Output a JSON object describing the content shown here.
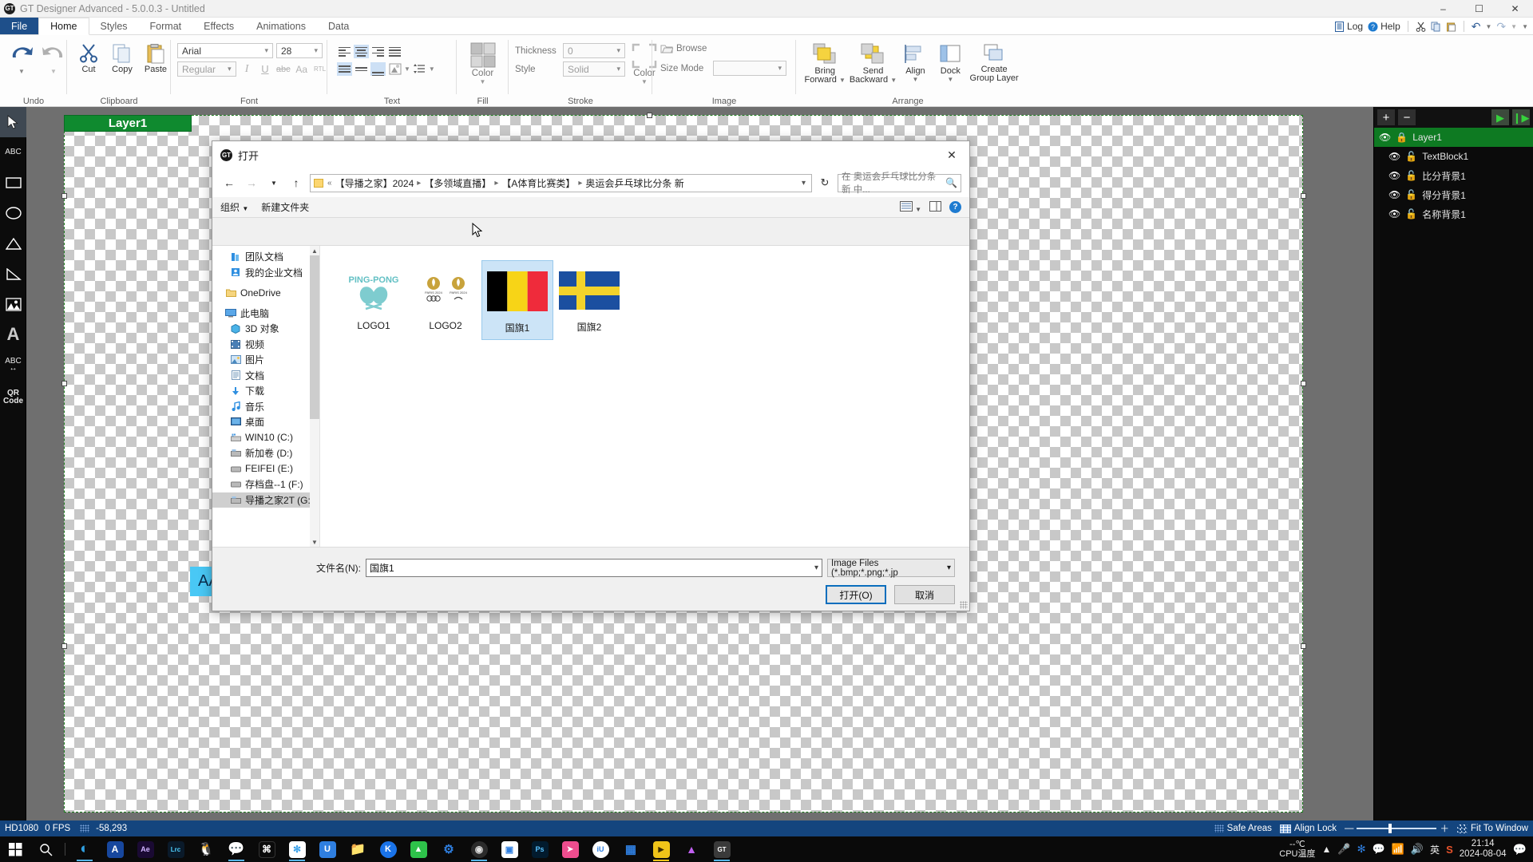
{
  "window": {
    "title": "GT Designer Advanced - 5.0.0.3 - Untitled",
    "app_icon": "gt-app-icon",
    "controls": {
      "minimize": "–",
      "maximize": "☐",
      "close": "✕"
    }
  },
  "ribbon": {
    "tabs": [
      {
        "label": "File",
        "kind": "file"
      },
      {
        "label": "Home",
        "kind": "active"
      },
      {
        "label": "Styles",
        "kind": "normal"
      },
      {
        "label": "Format",
        "kind": "normal"
      },
      {
        "label": "Effects",
        "kind": "normal"
      },
      {
        "label": "Animations",
        "kind": "normal"
      },
      {
        "label": "Data",
        "kind": "normal"
      }
    ],
    "quick_access": {
      "log_label": "Log",
      "help_label": "Help",
      "cut_icon": "cut-icon",
      "copy_icon": "copy-icon",
      "paste_icon": "paste-icon",
      "undo_icon": "undo-icon",
      "redo_icon": "redo-icon",
      "more_icon": "chevron-down-icon"
    },
    "groups": {
      "undo": {
        "label": "Undo",
        "undo_icon": "undo-arrow-icon",
        "redo_icon": "redo-arrow-icon"
      },
      "clipboard": {
        "label": "Clipboard",
        "cut": "Cut",
        "copy": "Copy",
        "paste": "Paste"
      },
      "font": {
        "label": "Font",
        "family_value": "Arial",
        "size_value": "28",
        "style_value": "Regular",
        "italic": "I",
        "underline": "U",
        "strike": "abc",
        "case": "Aa",
        "rtl": "RTL"
      },
      "text": {
        "label": "Text",
        "align_left": "align-left-icon",
        "align_center": "align-center-icon",
        "align_right": "align-right-icon",
        "align_justify": "align-justify-icon",
        "valign_top": "valign-top-icon",
        "valign_middle": "valign-middle-icon",
        "valign_bottom": "valign-bottom-icon",
        "wrap": "text-wrap-icon",
        "effects": "text-effects-icon",
        "line_spacing": "line-spacing-icon"
      },
      "fill": {
        "label": "Fill",
        "color_label": "Color",
        "swatch_icon": "fill-swatch-icon"
      },
      "stroke": {
        "label": "Stroke",
        "thickness_label": "Thickness",
        "thickness_value": "0",
        "style_label": "Style",
        "style_value": "Solid",
        "color_label": "Color",
        "swatch_icon": "stroke-swatch-icon"
      },
      "image": {
        "label": "Image",
        "browse_label": "Browse",
        "browse_icon": "folder-open-icon",
        "size_mode_label": "Size Mode",
        "size_mode_value": ""
      },
      "arrange": {
        "label": "Arrange",
        "bring_forward": "Bring\nForward",
        "bring_forward_l1": "Bring",
        "bring_forward_l2": "Forward",
        "send_backward_l1": "Send",
        "send_backward_l2": "Backward",
        "align_label": "Align",
        "dock_label": "Dock",
        "create_group_l1": "Create",
        "create_group_l2": "Group Layer"
      }
    }
  },
  "left_toolbar": [
    {
      "name": "select-tool",
      "glyph": "➤",
      "selected": true
    },
    {
      "name": "abc-text-tool",
      "glyph": "ABC",
      "selected": false
    },
    {
      "name": "rectangle-tool",
      "glyph": "▭",
      "selected": false
    },
    {
      "name": "ellipse-tool",
      "glyph": "◯",
      "selected": false
    },
    {
      "name": "triangle-tool",
      "glyph": "△",
      "selected": false
    },
    {
      "name": "right-triangle-tool",
      "glyph": "◥",
      "selected": false
    },
    {
      "name": "image-tool",
      "glyph": "Ὓc",
      "selected": false
    },
    {
      "name": "big-a-text-tool",
      "glyph": "A",
      "selected": false
    },
    {
      "name": "abc-scroll-tool",
      "glyph": "ABC",
      "selected": false
    },
    {
      "name": "qr-code-tool",
      "glyph": "QR Code",
      "selected": false
    }
  ],
  "canvas": {
    "layer_tag": "Layer1",
    "scoreboard_text": "AAA"
  },
  "layers_panel": {
    "add_icon": "plus-icon",
    "remove_icon": "minus-icon",
    "play_icon": "play-icon",
    "play_all_icon": "play-all-icon",
    "items": [
      {
        "name": "Layer1",
        "locked": true,
        "top": true,
        "visible": true
      },
      {
        "name": "TextBlock1",
        "locked": false,
        "top": false,
        "visible": true
      },
      {
        "name": "比分背景1",
        "locked": false,
        "top": false,
        "visible": true
      },
      {
        "name": "得分背景1",
        "locked": false,
        "top": false,
        "visible": true
      },
      {
        "name": "名称背景1",
        "locked": false,
        "top": false,
        "visible": true
      }
    ]
  },
  "status_bar": {
    "resolution": "HD1080",
    "fps": "0 FPS",
    "coords": "-58,293",
    "safe_areas": "Safe Areas",
    "align_lock": "Align Lock",
    "zoom_minus": "—",
    "zoom_plus": "＋",
    "fit": "Fit To Window"
  },
  "dialog": {
    "title": "打开",
    "close_icon": "close-icon",
    "nav": {
      "back_icon": "arrow-left-icon",
      "forward_icon": "arrow-right-icon",
      "recent_icon": "chevron-down-icon",
      "up_icon": "arrow-up-icon",
      "overflow": "«",
      "crumbs": [
        "【导播之家】2024",
        "【多领域直播】",
        "【A体育比赛类】",
        "奥运会乒乓球比分条 新"
      ],
      "refresh_icon": "refresh-icon",
      "search_placeholder": "在 奥运会乒乓球比分条 新 中...",
      "search_icon": "search-icon"
    },
    "commands": {
      "organize": "组织",
      "new_folder": "新建文件夹",
      "view_icon": "view-mode-icon",
      "preview_icon": "preview-pane-icon",
      "help_icon": "help-icon"
    },
    "sidebar": [
      {
        "label": "团队文档",
        "icon": "team-docs-icon",
        "indent": true,
        "selected": false
      },
      {
        "label": "我的企业文档",
        "icon": "enterprise-docs-icon",
        "indent": true,
        "selected": false
      },
      {
        "label": "OneDrive",
        "icon": "onedrive-folder-icon",
        "indent": false,
        "selected": false
      },
      {
        "label": "此电脑",
        "icon": "this-pc-icon",
        "indent": false,
        "selected": false
      },
      {
        "label": "3D 对象",
        "icon": "3d-objects-icon",
        "indent": true,
        "selected": false
      },
      {
        "label": "视频",
        "icon": "videos-icon",
        "indent": true,
        "selected": false
      },
      {
        "label": "图片",
        "icon": "pictures-icon",
        "indent": true,
        "selected": false
      },
      {
        "label": "文档",
        "icon": "documents-icon",
        "indent": true,
        "selected": false
      },
      {
        "label": "下载",
        "icon": "downloads-icon",
        "indent": true,
        "selected": false
      },
      {
        "label": "音乐",
        "icon": "music-icon",
        "indent": true,
        "selected": false
      },
      {
        "label": "桌面",
        "icon": "desktop-icon",
        "indent": true,
        "selected": false
      },
      {
        "label": "WIN10 (C:)",
        "icon": "drive-c-icon",
        "indent": true,
        "selected": false
      },
      {
        "label": "新加卷 (D:)",
        "icon": "drive-d-icon",
        "indent": true,
        "selected": false
      },
      {
        "label": "FEIFEI (E:)",
        "icon": "drive-e-icon",
        "indent": true,
        "selected": false
      },
      {
        "label": "存档盘--1 (F:)",
        "icon": "drive-f-icon",
        "indent": true,
        "selected": false
      },
      {
        "label": "导播之家2T (G:)",
        "icon": "drive-g-icon",
        "indent": true,
        "selected": true
      }
    ],
    "files": [
      {
        "name": "LOGO1",
        "thumb": "ping-pong-logo",
        "selected": false
      },
      {
        "name": "LOGO2",
        "thumb": "paris-2024-logo",
        "selected": false
      },
      {
        "name": "国旗1",
        "thumb": "belgium-flag",
        "selected": true
      },
      {
        "name": "国旗2",
        "thumb": "sweden-flag",
        "selected": false
      }
    ],
    "footer": {
      "filename_label": "文件名(N):",
      "filename_value": "国旗1",
      "filter_value": "Image Files (*.bmp;*.png;*.jp",
      "open_button": "打开(O)",
      "cancel_button": "取消"
    }
  },
  "taskbar": {
    "start_icon": "windows-start-icon",
    "search_icon": "search-icon",
    "items": [
      {
        "name": "edge-icon",
        "glyph": "◐",
        "color": "#1b74c4",
        "bg": "transparent",
        "active": true
      },
      {
        "name": "arctime-icon",
        "glyph": "A",
        "color": "#ffffff",
        "bg": "#17479e",
        "active": false
      },
      {
        "name": "after-effects-icon",
        "glyph": "Ae",
        "color": "#cfb3ff",
        "bg": "#1a0a33",
        "active": false
      },
      {
        "name": "lightroom-classic-icon",
        "glyph": "Lrc",
        "color": "#4fd0ff",
        "bg": "#0a1a2a",
        "active": false
      },
      {
        "name": "qq-icon",
        "glyph": "♣",
        "color": "#ffffff",
        "bg": "transparent",
        "active": false
      },
      {
        "name": "wechat-icon",
        "glyph": "●",
        "color": "#ffffff",
        "bg": "#2dc100",
        "active": true
      },
      {
        "name": "capcut-icon",
        "glyph": "⧗",
        "color": "#ffffff",
        "bg": "#0b0b0b",
        "active": false
      },
      {
        "name": "tim-icon",
        "glyph": "✵",
        "color": "#2d8cf0",
        "bg": "#ffffff",
        "active": true
      },
      {
        "name": "ubox-icon",
        "glyph": "U",
        "color": "#ffffff",
        "bg": "#2f7fe0",
        "active": false
      },
      {
        "name": "file-explorer-icon",
        "glyph": "▤",
        "color": "#f6c760",
        "bg": "transparent",
        "active": false
      },
      {
        "name": "kugou-icon",
        "glyph": "K",
        "color": "#ffffff",
        "bg": "#1a73e8",
        "active": false
      },
      {
        "name": "mgtv-icon",
        "glyph": "▲",
        "color": "#ffffff",
        "bg": "#2ec24a",
        "active": false
      },
      {
        "name": "settings-gears-icon",
        "glyph": "⚙",
        "color": "#2f7fe0",
        "bg": "transparent",
        "active": false
      },
      {
        "name": "obs-studio-icon",
        "glyph": "◌",
        "color": "#dddddd",
        "bg": "#2b2b2b",
        "active": true
      },
      {
        "name": "screen-capture-icon",
        "glyph": "▣",
        "color": "#2f7fe0",
        "bg": "#ffffff",
        "active": false
      },
      {
        "name": "photoshop-icon",
        "glyph": "Ps",
        "color": "#59c3ff",
        "bg": "#021b2e",
        "active": false
      },
      {
        "name": "clipchamp-icon",
        "glyph": "➤",
        "color": "#ffffff",
        "bg": "#ee4d8e",
        "active": false
      },
      {
        "name": "iu-icon",
        "glyph": "iU",
        "color": "#2f7fe0",
        "bg": "#ffffff",
        "active": false
      },
      {
        "name": "tiles-icon",
        "glyph": "▦",
        "color": "#2f7fe0",
        "bg": "transparent",
        "active": false
      },
      {
        "name": "player-icon",
        "glyph": "▶",
        "color": "#3a2a00",
        "bg": "#f0c419",
        "active": true,
        "label": "Player"
      },
      {
        "name": "mi-creative-icon",
        "glyph": "▲",
        "color": "#c060f0",
        "bg": "transparent",
        "active": false
      },
      {
        "name": "gt-designer-icon",
        "glyph": "GT",
        "color": "#ffffff",
        "bg": "#3a3a3a",
        "active": true
      }
    ],
    "tray": {
      "cpu_temp_value": "--℃",
      "cpu_temp_label": "CPU温度",
      "chevron_icon": "chevron-up-icon",
      "mic_icon": "microphone-icon",
      "tim_icon": "tim-tray-icon",
      "wechat_icon": "wechat-tray-icon",
      "wifi_icon": "wifi-icon",
      "volume_icon": "volume-icon",
      "ime_label": "英",
      "sogou_icon": "sogou-ime-icon",
      "time": "21:14",
      "date": "2024-08-04",
      "notification_icon": "notification-icon"
    }
  }
}
